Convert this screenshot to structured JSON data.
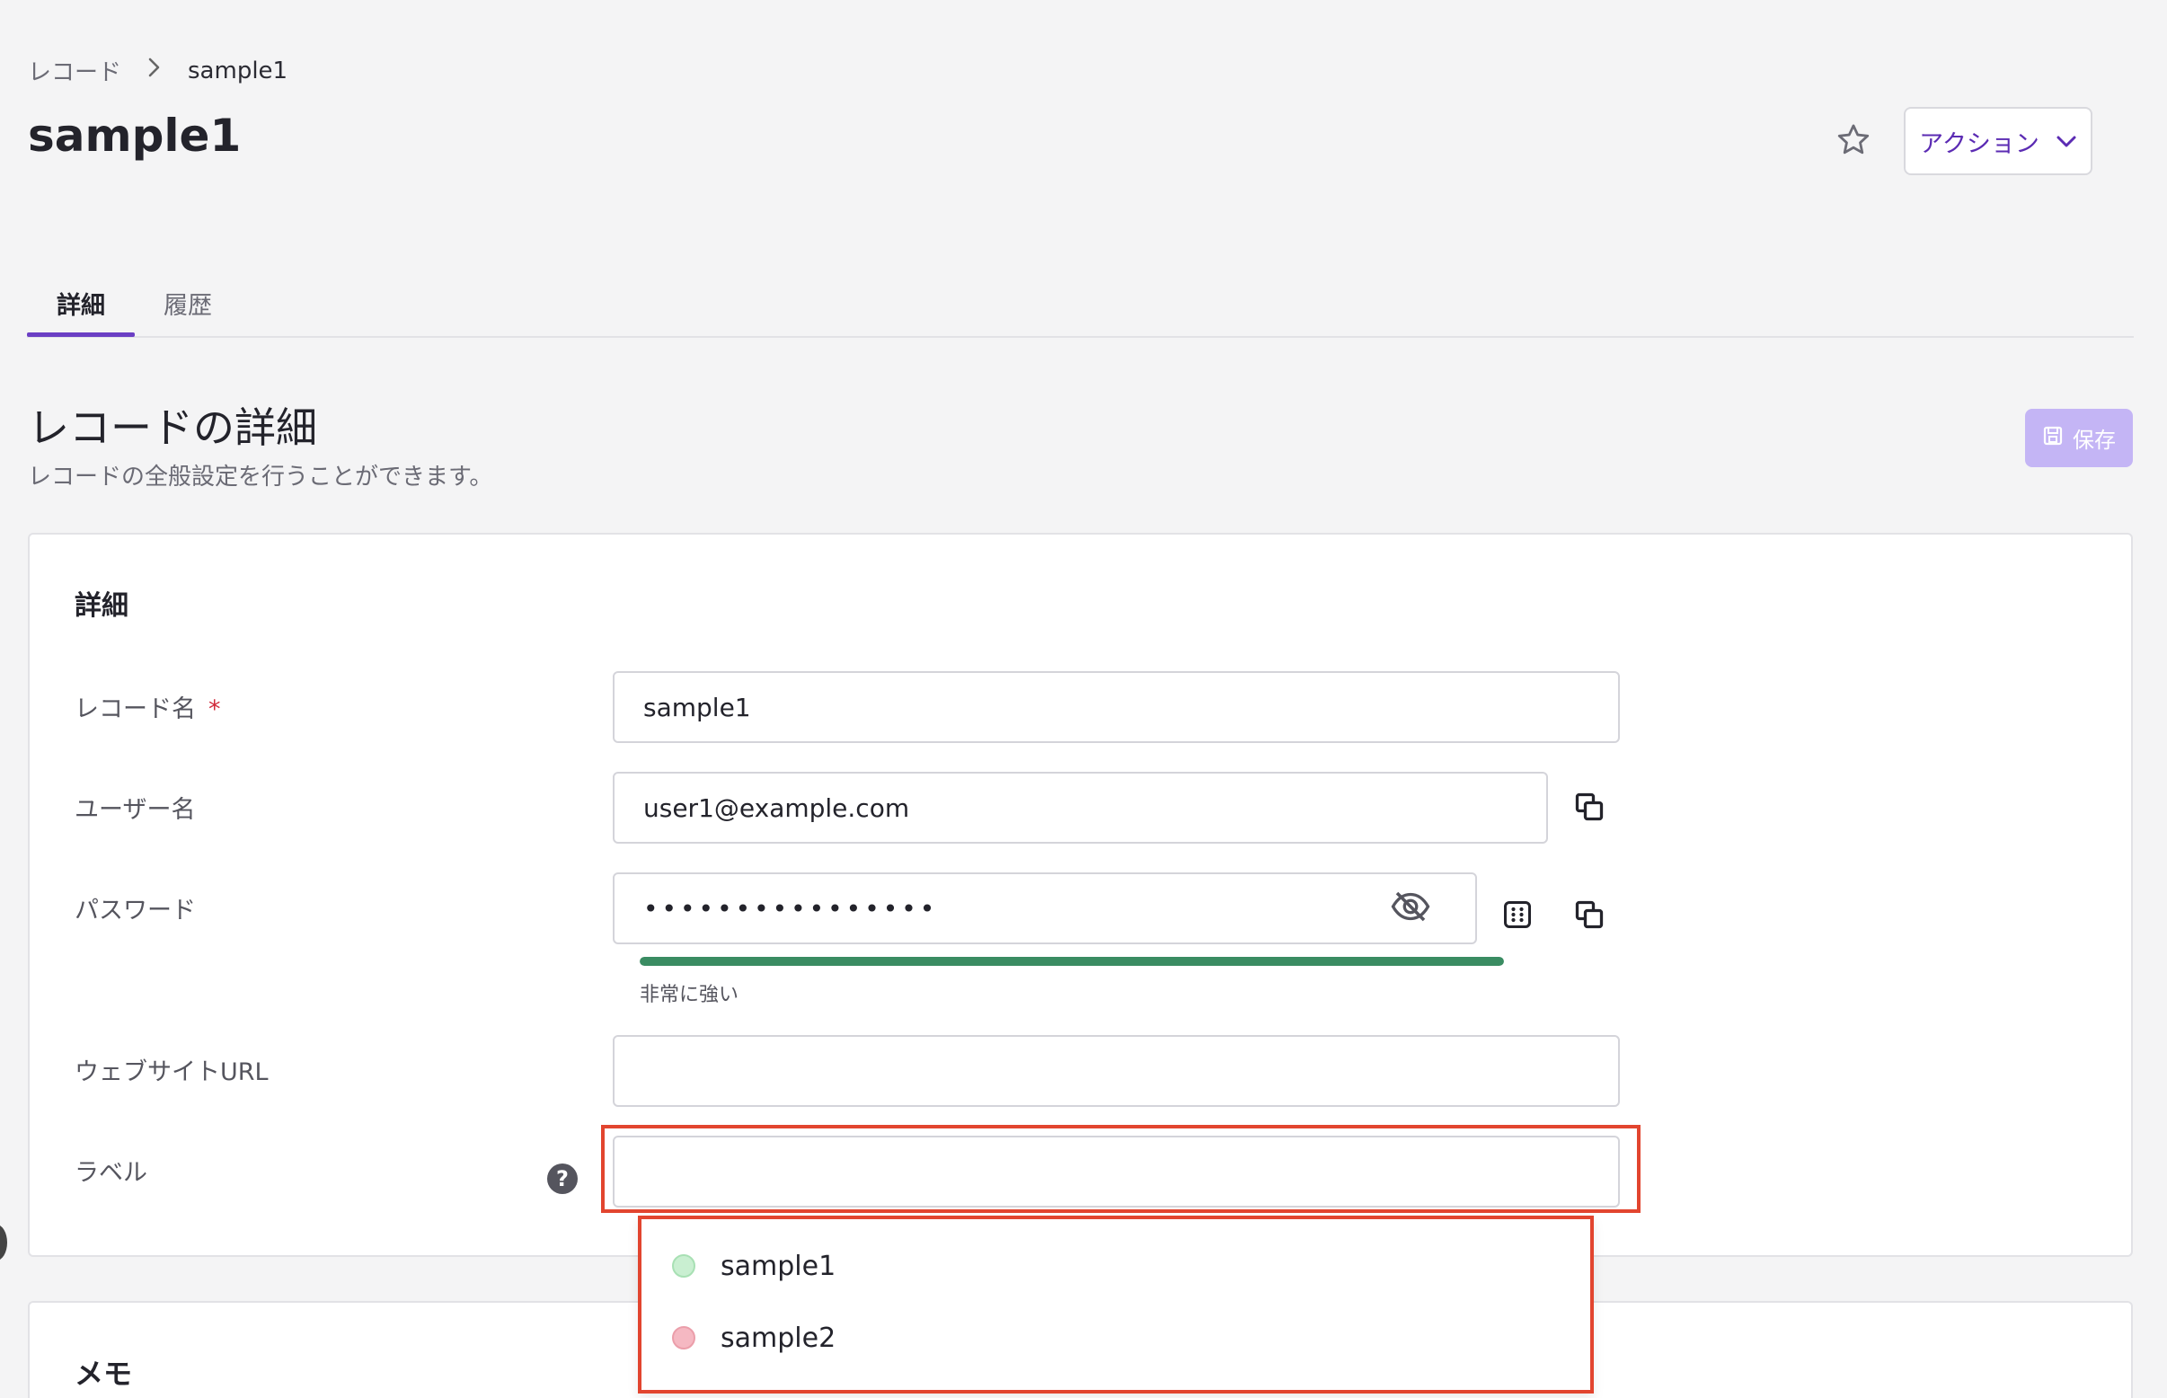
{
  "breadcrumb": {
    "parent": "レコード",
    "separator": ">",
    "current": "sample1"
  },
  "header": {
    "title": "sample1",
    "action_label": "アクション"
  },
  "tabs": [
    {
      "label": "詳細",
      "active": true
    },
    {
      "label": "履歴",
      "active": false
    }
  ],
  "section": {
    "title": "レコードの詳細",
    "description": "レコードの全般設定を行うことができます。",
    "save_label": "保存"
  },
  "details_card": {
    "heading": "詳細",
    "fields": {
      "record_name": {
        "label": "レコード名",
        "required_mark": "*",
        "value": "sample1"
      },
      "username": {
        "label": "ユーザー名",
        "value": "user1@example.com"
      },
      "password": {
        "label": "パスワード",
        "value": "••••••••••••••••",
        "strength_text": "非常に強い",
        "strength": 1.0
      },
      "website": {
        "label": "ウェブサイトURL",
        "value": ""
      },
      "label": {
        "label": "ラベル",
        "value": "",
        "help": "?"
      }
    }
  },
  "label_dropdown": {
    "options": [
      {
        "label": "sample1",
        "color": "#c9efd1",
        "border": "#a8e0b4"
      },
      {
        "label": "sample2",
        "color": "#f5b8c2",
        "border": "#eb9eaa"
      }
    ]
  },
  "memo_card": {
    "heading": "メモ"
  },
  "colors": {
    "accent": "#6b3fc4",
    "strength_bar": "#3a8c62",
    "highlight": "#e2452f"
  }
}
